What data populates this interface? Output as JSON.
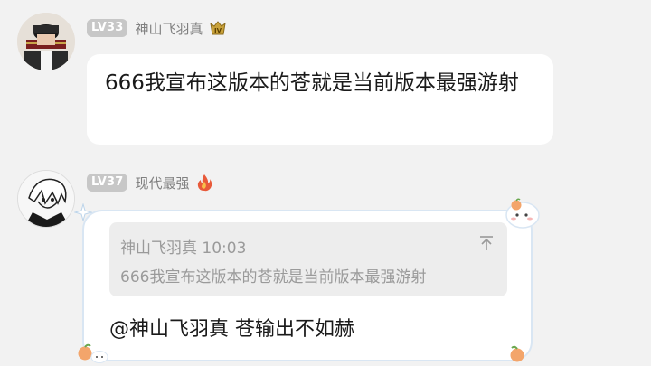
{
  "messages": [
    {
      "level": "LV33",
      "nickname": "神山飞羽真",
      "title_icon": "rank-crest-icon",
      "text": "666我宣布这版本的苍就是当前版本最强游射"
    },
    {
      "level": "LV37",
      "nickname": "现代最强",
      "title_icon": "flame-icon",
      "quote": {
        "author": "神山飞羽真",
        "time": "10:03",
        "text": "666我宣布这版本的苍就是当前版本最强游射"
      },
      "text": "@神山飞羽真 苍输出不如赫"
    }
  ],
  "colors": {
    "background": "#f2f2f2",
    "bubble": "#ffffff",
    "badge": "#c7c7c7",
    "quote_bg": "#ededed",
    "frame": "#d9e6f3"
  }
}
